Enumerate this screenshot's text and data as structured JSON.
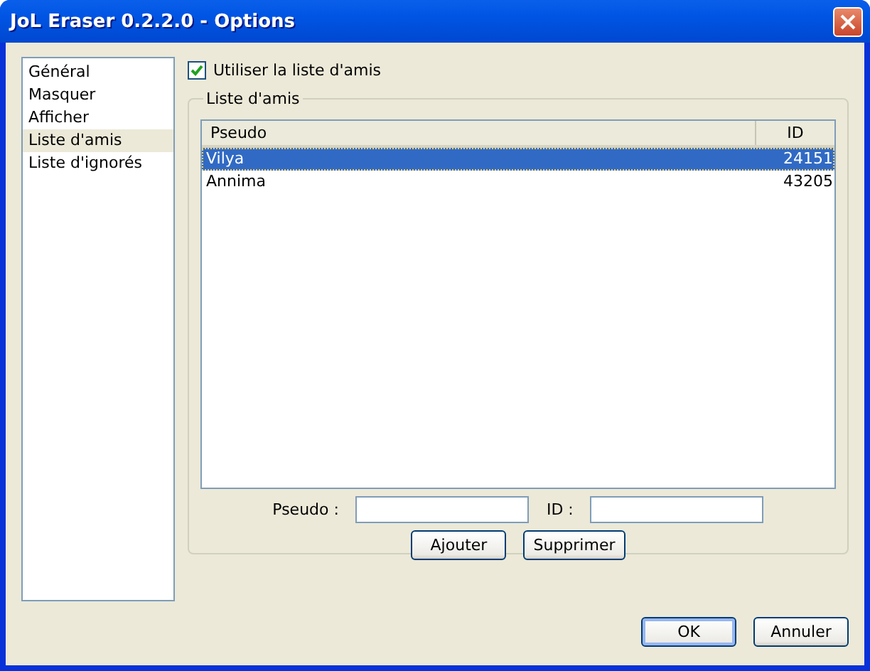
{
  "window": {
    "title": "JoL Eraser 0.2.2.0 - Options"
  },
  "sidebar": {
    "items": [
      {
        "label": "Général",
        "selected": false
      },
      {
        "label": "Masquer",
        "selected": false
      },
      {
        "label": "Afficher",
        "selected": false
      },
      {
        "label": "Liste d'amis",
        "selected": true
      },
      {
        "label": "Liste d'ignorés",
        "selected": false
      }
    ]
  },
  "use_friends": {
    "label": "Utiliser la liste d'amis",
    "checked": true
  },
  "group": {
    "title": "Liste d'amis"
  },
  "table": {
    "columns": [
      "Pseudo",
      "ID"
    ],
    "rows": [
      {
        "cells": [
          "Vilya",
          "24151"
        ],
        "selected": true
      },
      {
        "cells": [
          "Annima",
          "43205"
        ],
        "selected": false
      }
    ]
  },
  "form": {
    "pseudo_label": "Pseudo :",
    "id_label": "ID :"
  },
  "actions": [
    "Ajouter",
    "Supprimer"
  ],
  "buttons": [
    {
      "label": "OK",
      "default": true
    },
    {
      "label": "Annuler",
      "default": false
    }
  ]
}
